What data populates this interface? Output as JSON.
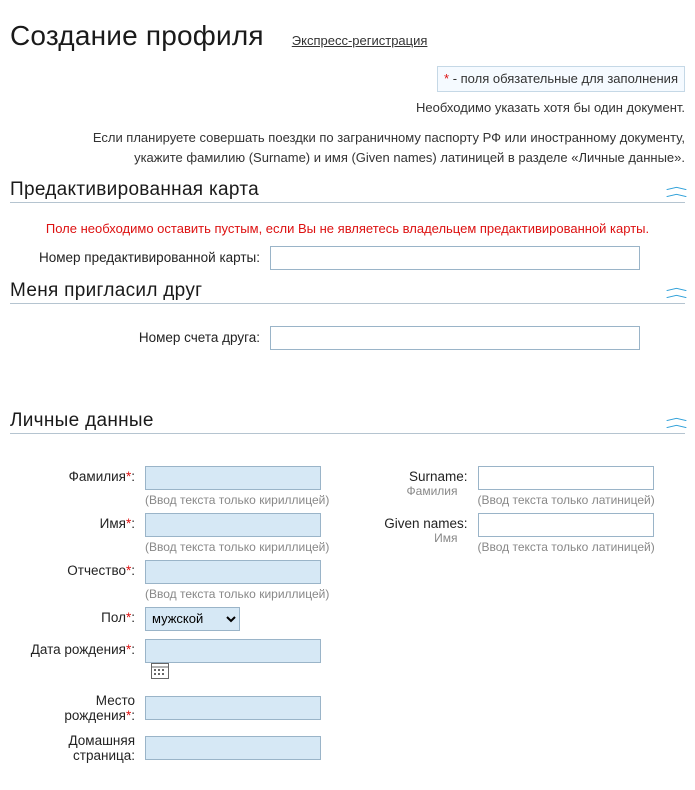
{
  "header": {
    "title": "Создание профиля",
    "express_link": "Экспресс-регистрация"
  },
  "preamble": {
    "star": "*",
    "required_suffix": " - поля обязательные для заполнения",
    "atleast_doc": "Необходимо указать хотя бы один документ.",
    "foreign_line1": "Если планируете совершать поездки по заграничному паспорту РФ или иностранному документу,",
    "foreign_line2": "укажите фамилию (Surname) и имя (Given names) латиницей в разделе «Личные данные»."
  },
  "sections": {
    "precard": {
      "title": "Предактивированная карта",
      "warning": "Поле необходимо оставить пустым, если Вы не являетесь владельцем предактивированной карты.",
      "card_label": "Номер предактивированной карты:"
    },
    "friend": {
      "title": "Меня пригласил друг",
      "friend_label": "Номер счета друга:"
    },
    "personal": {
      "title": "Личные данные",
      "surname_ru": "Фамилия",
      "name_ru": "Имя",
      "patronymic": "Отчество",
      "hint_cyr": "(Ввод текста только кириллицей)",
      "surname_en": "Surname:",
      "surname_en_sub": "Фамилия",
      "givennames_en": "Given names:",
      "givennames_en_sub": "Имя",
      "hint_lat": "(Ввод текста только латиницей)",
      "gender": "Пол",
      "gender_value": "мужской",
      "dob": "Дата рождения",
      "pob1": "Место",
      "pob2": "рождения",
      "homepage1": "Домашняя",
      "homepage2": "страница"
    }
  },
  "punct": {
    "star": "*",
    "colon": ":"
  }
}
